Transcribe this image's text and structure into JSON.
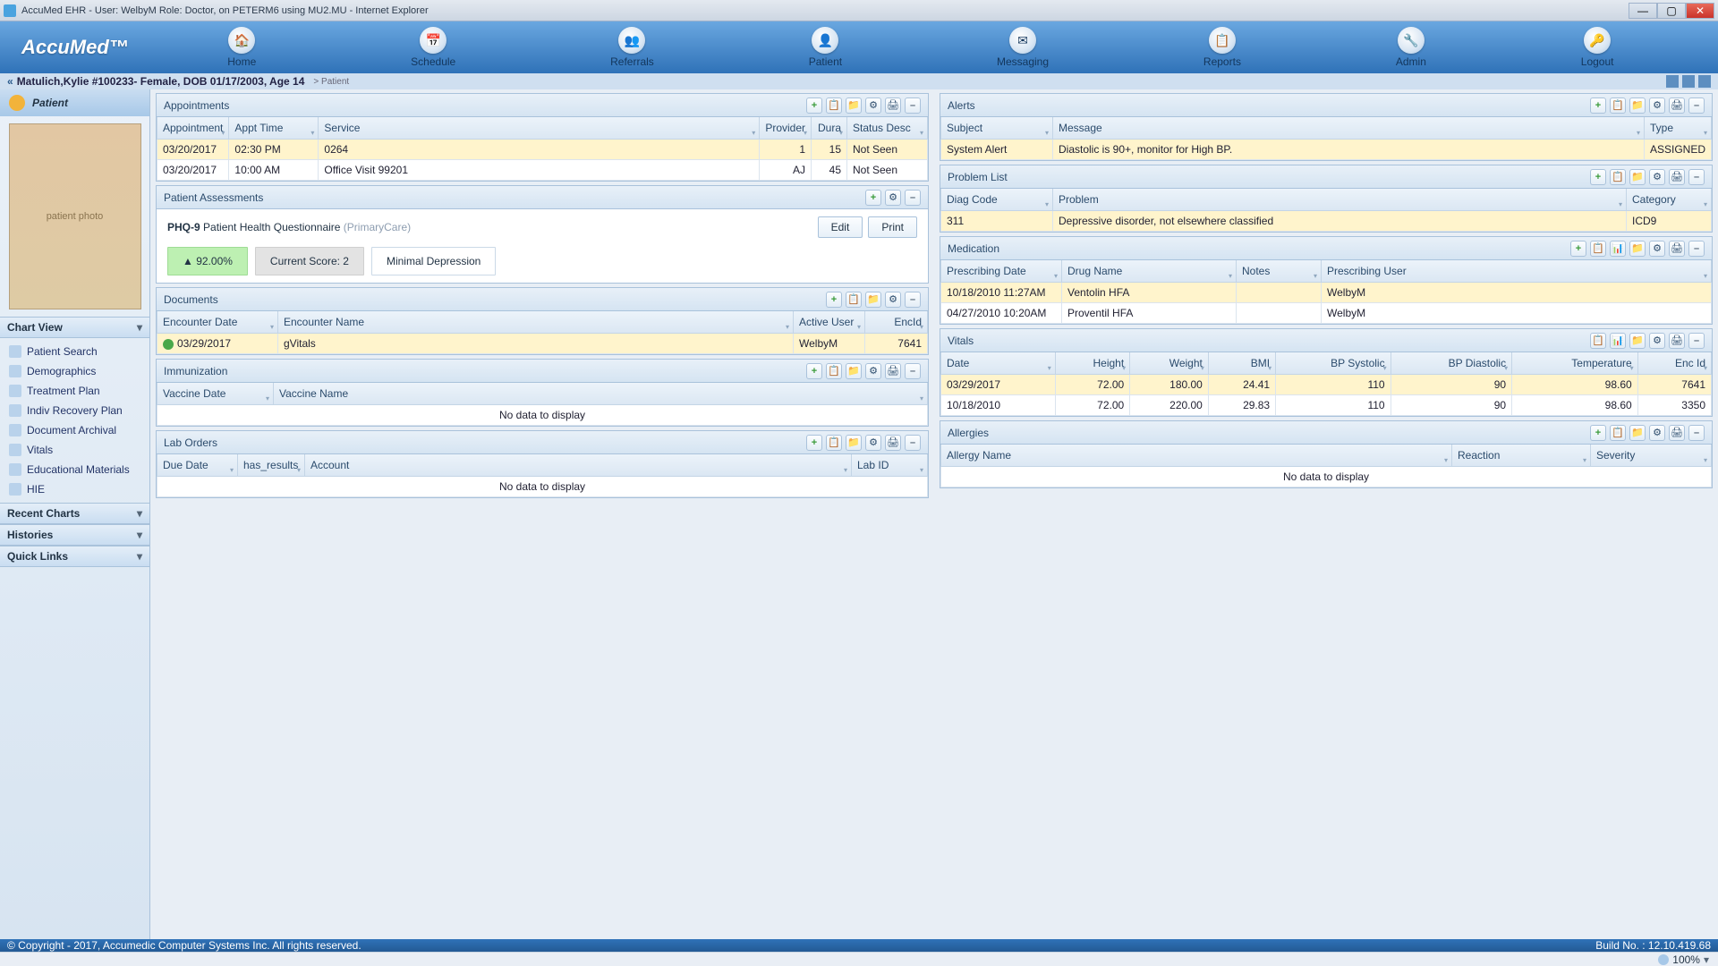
{
  "window": {
    "title": "AccuMed EHR - User: WelbyM Role: Doctor, on PETERM6 using MU2.MU - Internet Explorer"
  },
  "app": {
    "logo": "AccuMed™"
  },
  "nav": {
    "items": [
      {
        "label": "Home",
        "icon": "🏠"
      },
      {
        "label": "Schedule",
        "icon": "📅"
      },
      {
        "label": "Referrals",
        "icon": "👥"
      },
      {
        "label": "Patient",
        "icon": "👤"
      },
      {
        "label": "Messaging",
        "icon": "✉"
      },
      {
        "label": "Reports",
        "icon": "📋"
      },
      {
        "label": "Admin",
        "icon": "🔧"
      },
      {
        "label": "Logout",
        "icon": "🔑"
      }
    ]
  },
  "banner": {
    "back": "«",
    "text": "Matulich,Kylie #100233- Female, DOB 01/17/2003, Age 14",
    "crumb": "> Patient"
  },
  "sidebar": {
    "title": "Patient",
    "photo_placeholder": "patient photo",
    "sections": [
      {
        "label": "Chart View",
        "links": [
          {
            "label": "Patient Search"
          },
          {
            "label": "Demographics"
          },
          {
            "label": "Treatment Plan"
          },
          {
            "label": "Indiv Recovery Plan"
          },
          {
            "label": "Document Archival"
          },
          {
            "label": "Vitals"
          },
          {
            "label": "Educational Materials"
          },
          {
            "label": "HIE"
          }
        ]
      },
      {
        "label": "Recent Charts",
        "links": []
      },
      {
        "label": "Histories",
        "links": []
      },
      {
        "label": "Quick Links",
        "links": []
      }
    ]
  },
  "panels": {
    "appointments": {
      "title": "Appointments",
      "cols": [
        "Appointment",
        "Appt Time",
        "Service",
        "Provider",
        "Dura",
        "Status Desc"
      ],
      "rows": [
        [
          "03/20/2017",
          "02:30 PM",
          "0264",
          "1",
          "15",
          "Not Seen"
        ],
        [
          "03/20/2017",
          "10:00 AM",
          "Office Visit 99201",
          "AJ",
          "45",
          "Not Seen"
        ]
      ]
    },
    "assessment": {
      "title": "Patient Assessments",
      "code": "PHQ-9",
      "name": "Patient Health Questionnaire",
      "context": "(PrimaryCare)",
      "edit": "Edit",
      "print": "Print",
      "pct": "▲ 92.00%",
      "score": "Current Score: 2",
      "level": "Minimal Depression"
    },
    "documents": {
      "title": "Documents",
      "cols": [
        "Encounter Date",
        "Encounter Name",
        "Active User",
        "EncId"
      ],
      "rows": [
        [
          "03/29/2017",
          "gVitals",
          "WelbyM",
          "7641"
        ]
      ]
    },
    "immunization": {
      "title": "Immunization",
      "cols": [
        "Vaccine Date",
        "Vaccine Name"
      ],
      "empty": "No data to display"
    },
    "labs": {
      "title": "Lab Orders",
      "cols": [
        "Due Date",
        "has_results",
        "Account",
        "Lab ID"
      ],
      "empty": "No data to display"
    },
    "alerts": {
      "title": "Alerts",
      "cols": [
        "Subject",
        "Message",
        "Type"
      ],
      "rows": [
        [
          "System Alert",
          "Diastolic is 90+, monitor for High BP.",
          "ASSIGNED"
        ]
      ]
    },
    "problems": {
      "title": "Problem List",
      "cols": [
        "Diag Code",
        "Problem",
        "Category"
      ],
      "rows": [
        [
          "311",
          "Depressive disorder, not elsewhere classified",
          "ICD9"
        ]
      ]
    },
    "medication": {
      "title": "Medication",
      "cols": [
        "Prescribing Date",
        "Drug Name",
        "Notes",
        "Prescribing User"
      ],
      "rows": [
        [
          "10/18/2010 11:27AM",
          "Ventolin HFA",
          "",
          "WelbyM"
        ],
        [
          "04/27/2010 10:20AM",
          "Proventil HFA",
          "",
          "WelbyM"
        ]
      ]
    },
    "vitals": {
      "title": "Vitals",
      "cols": [
        "Date",
        "Height",
        "Weight",
        "BMI",
        "BP Systolic",
        "BP Diastolic",
        "Temperature",
        "Enc Id"
      ],
      "rows": [
        [
          "03/29/2017",
          "72.00",
          "180.00",
          "24.41",
          "110",
          "90",
          "98.60",
          "7641"
        ],
        [
          "10/18/2010",
          "72.00",
          "220.00",
          "29.83",
          "110",
          "90",
          "98.60",
          "3350"
        ]
      ]
    },
    "allergies": {
      "title": "Allergies",
      "cols": [
        "Allergy Name",
        "Reaction",
        "Severity"
      ],
      "empty": "No data to display"
    }
  },
  "footer": {
    "copyright": "© Copyright - 2017, Accumedic Computer Systems Inc. All rights reserved.",
    "build": "Build No. : 12.10.419.68"
  },
  "status": {
    "zoom": "100%"
  }
}
